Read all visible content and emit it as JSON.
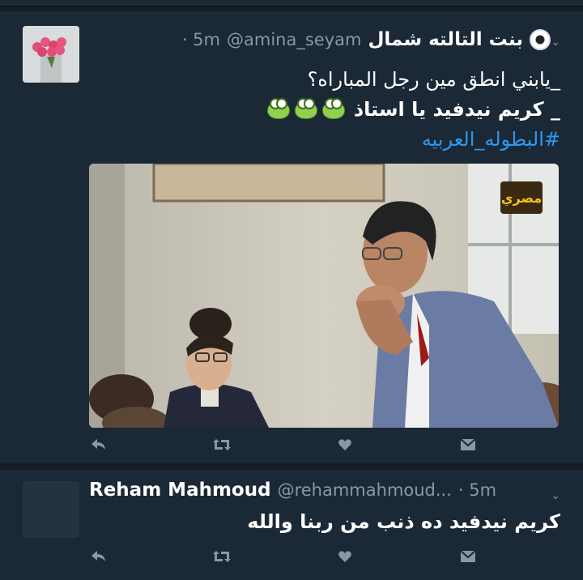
{
  "tweets": [
    {
      "display_name": "بنت التالته شمال",
      "handle": "@amina_seyam",
      "time": "· 5m",
      "lines": [
        "_يابني انطق مين رجل المباراه؟",
        "_ كريم نيدفيد يا استاذ"
      ],
      "hashtag": "#البطوله_العربيه",
      "media": {
        "logo_text": "ﻣﺼﺮﻱ"
      }
    },
    {
      "display_name": "Reham Mahmoud",
      "handle": "@rehammahmoud...",
      "time": "· 5m",
      "lines": [
        "كريم نيدفيد ده ذنب من ربنا والله"
      ]
    }
  ],
  "icons": {
    "reply": "reply-icon",
    "retweet": "retweet-icon",
    "like": "heart-icon",
    "dm": "envelope-icon",
    "more": "chevron-down-icon"
  }
}
